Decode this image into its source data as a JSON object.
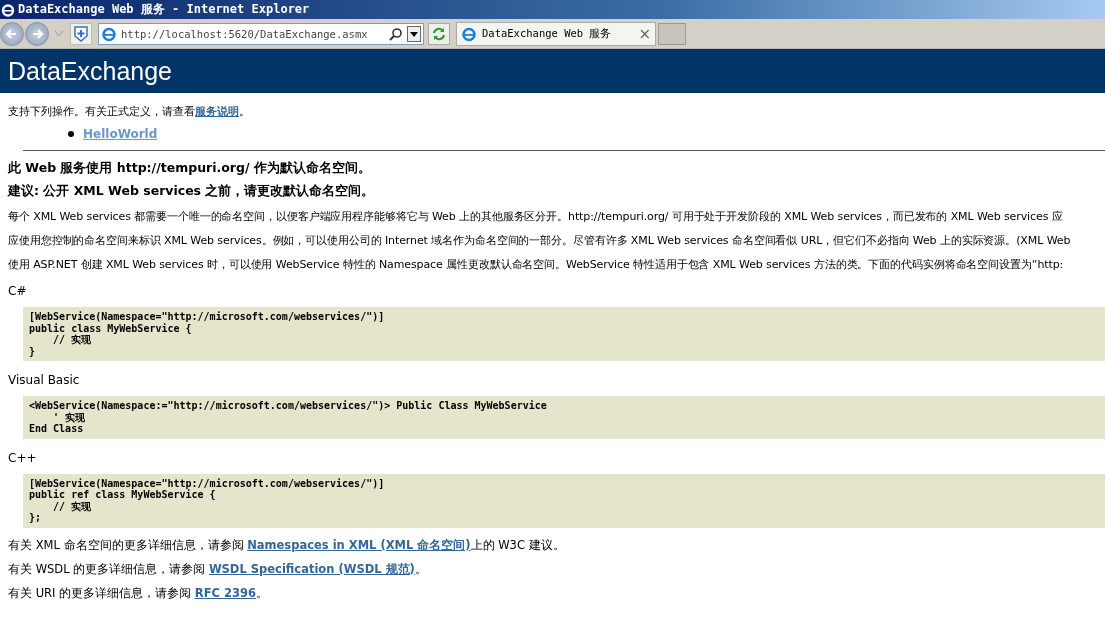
{
  "window": {
    "title": "DataExchange Web 服务 - Internet Explorer"
  },
  "toolbar": {
    "address": "http://localhost:5620/DataExchange.asmx",
    "tab_title": "DataExchange Web 服务",
    "tab_close": "×"
  },
  "page": {
    "heading": "DataExchange",
    "intro": {
      "text": "支持下列操作。有关正式定义，请查看",
      "link": "服务说明",
      "suffix": "。"
    },
    "operations": [
      "HelloWorld"
    ],
    "notice": "此 Web 服务使用 http://tempuri.org/ 作为默认命名空间。",
    "recommendation": "建议: 公开 XML Web services 之前，请更改默认命名空间。",
    "paragraph_lines": [
      "每个 XML Web services 都需要一个唯一的命名空间，以便客户端应用程序能够将它与 Web 上的其他服务区分开。http://tempuri.org/ 可用于处于开发阶段的 XML Web services，而已发布的 XML Web services 应",
      "应使用您控制的命名空间来标识 XML Web services。例如，可以使用公司的 Internet 域名作为命名空间的一部分。尽管有许多 XML Web services 命名空间看似 URL，但它们不必指向 Web 上的实际资源。(XML Web",
      "使用 ASP.NET 创建 XML Web services 时，可以使用 WebService 特性的 Namespace 属性更改默认命名空间。WebService 特性适用于包含 XML Web services 方法的类。下面的代码实例将命名空间设置为“http:"
    ],
    "code_samples": [
      {
        "language": "C#",
        "code": "[WebService(Namespace=\"http://microsoft.com/webservices/\")]\npublic class MyWebService {\n    // 实现\n}"
      },
      {
        "language": "Visual Basic",
        "code": "<WebService(Namespace:=\"http://microsoft.com/webservices/\")> Public Class MyWebService\n    ' 实现\nEnd Class"
      },
      {
        "language": "C++",
        "code": "[WebService(Namespace=\"http://microsoft.com/webservices/\")]\npublic ref class MyWebService {\n    // 实现\n};"
      }
    ],
    "references": [
      {
        "prefix": "有关 XML 命名空间的更多详细信息，请参阅 ",
        "link": "Namespaces in XML (XML 命名空间)",
        "suffix": "上的 W3C 建议。"
      },
      {
        "prefix": "有关 WSDL 的更多详细信息，请参阅 ",
        "link": "WSDL Specification (WSDL 规范)",
        "suffix": "。"
      },
      {
        "prefix": "有关 URI 的更多详细信息，请参阅 ",
        "link": "RFC 2396",
        "suffix": "。"
      }
    ]
  }
}
